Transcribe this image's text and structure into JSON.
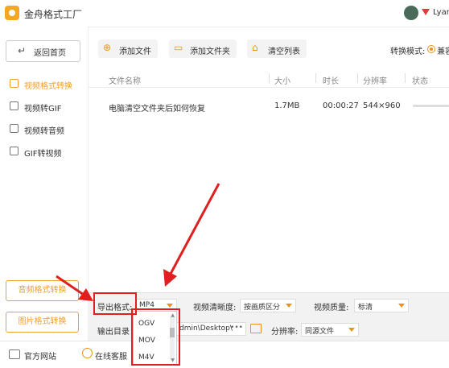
{
  "app": {
    "title": "金舟格式工厂",
    "username": "Lyan"
  },
  "sidebar": {
    "back_label": "返回首页",
    "items": [
      {
        "label": "视频格式转换",
        "active": true
      },
      {
        "label": "视频转GIF",
        "active": false
      },
      {
        "label": "视频转音频",
        "active": false
      },
      {
        "label": "GIF转视频",
        "active": false
      }
    ],
    "audio_convert_label": "音频格式转换",
    "image_convert_label": "图片格式转换"
  },
  "toolbar": {
    "add_file": "添加文件",
    "add_folder": "添加文件夹",
    "clear_list": "清空列表",
    "mode_label": "转换模式:",
    "mode_value": "兼容"
  },
  "table": {
    "columns": [
      "文件名称",
      "大小",
      "时长",
      "分辨率",
      "状态"
    ],
    "rows": [
      {
        "name": "电脑清空文件夹后如何恢复",
        "size": "1.7MB",
        "duration": "00:00:27",
        "resolution": "544×960"
      }
    ]
  },
  "settings": {
    "export_format_label": "导出格式:",
    "export_format_value": "MP4",
    "clarity_label": "视频清晰度:",
    "clarity_value": "按画质区分",
    "quality_label": "视频质量:",
    "quality_value": "标清",
    "output_dir_label": "输出目录",
    "output_dir_value": "dmin\\Desktop\\",
    "output_dir_more": "•••",
    "resolution_label": "分辨率:",
    "resolution_value": "同源文件"
  },
  "format_dropdown": {
    "options": [
      "OGV",
      "MOV",
      "M4V"
    ]
  },
  "footer": {
    "website": "官方网站",
    "service": "在线客服"
  },
  "colors": {
    "accent": "#f0a030",
    "annotation": "#e02020"
  }
}
